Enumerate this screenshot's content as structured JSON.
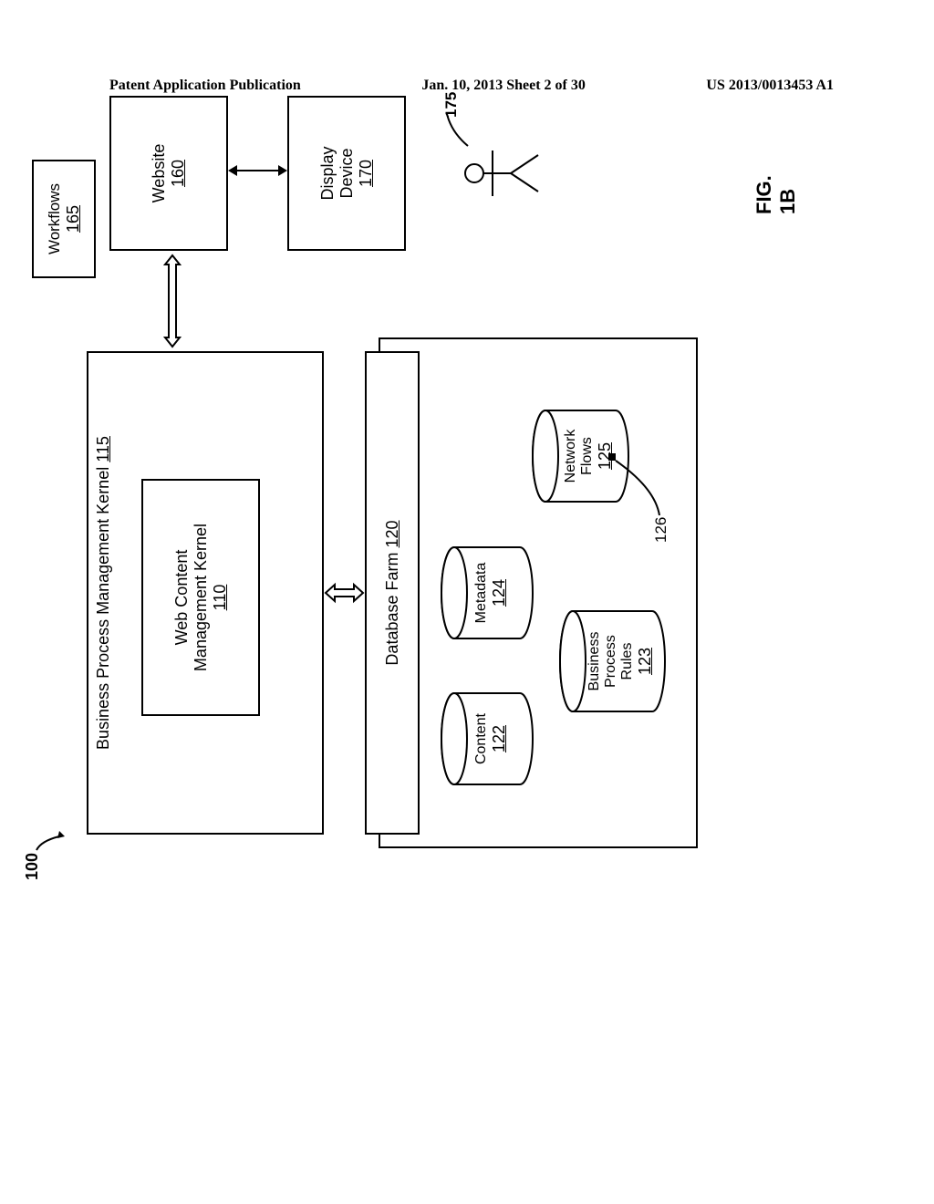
{
  "header": {
    "left": "Patent Application Publication",
    "center": "Jan. 10, 2013  Sheet 2 of 30",
    "right": "US 2013/0013453 A1"
  },
  "figure": {
    "label": "FIG. 1B",
    "ref_system": "100",
    "ref_user": "175",
    "ref_node": "126"
  },
  "blocks": {
    "bpm": {
      "title": "Business Process Management Kernel",
      "ref": "115"
    },
    "wcm": {
      "title_l1": "Web Content",
      "title_l2": "Management Kernel",
      "ref": "110"
    },
    "dbfarm": {
      "title": "Database Farm",
      "ref": "120"
    },
    "workflows": {
      "title": "Workflows",
      "ref": "165"
    },
    "website": {
      "title": "Website",
      "ref": "160"
    },
    "display": {
      "title_l1": "Display",
      "title_l2": "Device",
      "ref": "170"
    }
  },
  "cylinders": {
    "content": {
      "title": "Content",
      "ref": "122"
    },
    "metadata": {
      "title": "Metadata",
      "ref": "124"
    },
    "bpr": {
      "title_l1": "Business",
      "title_l2": "Process",
      "title_l3": "Rules",
      "ref": "123"
    },
    "nflows": {
      "title_l1": "Network",
      "title_l2": "Flows",
      "ref": "125"
    }
  }
}
